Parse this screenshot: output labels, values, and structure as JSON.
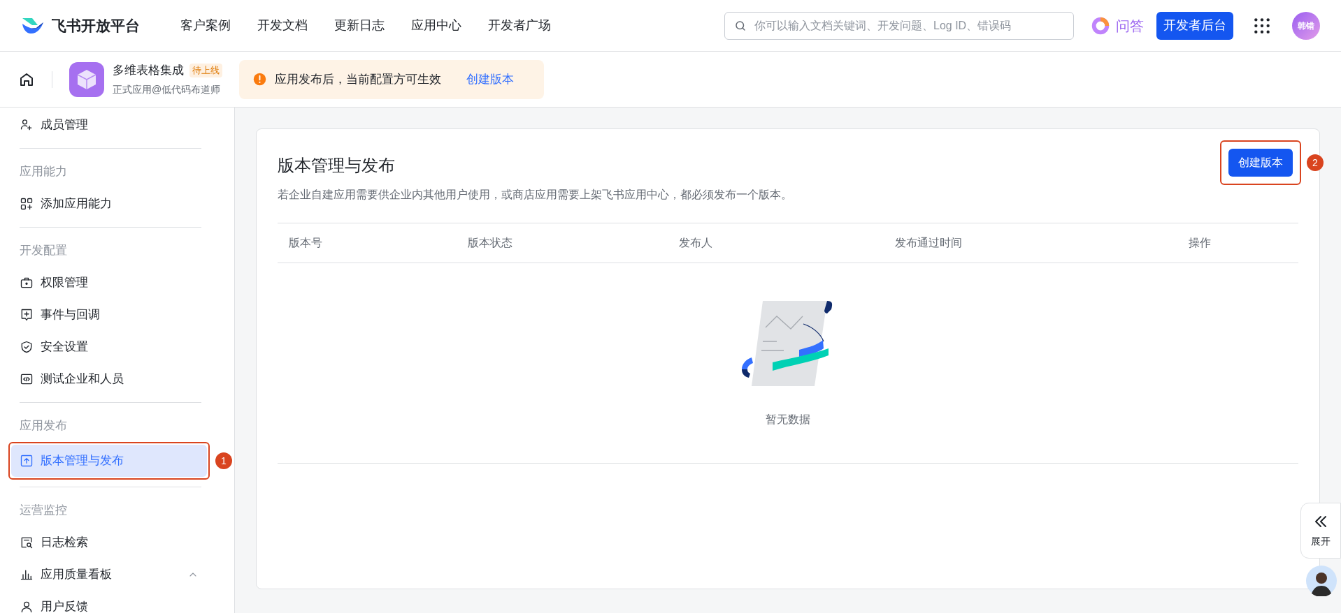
{
  "top_nav": {
    "logo_text": "飞书开放平台",
    "links": [
      {
        "label": "客户案例"
      },
      {
        "label": "开发文档"
      },
      {
        "label": "更新日志"
      },
      {
        "label": "应用中心"
      },
      {
        "label": "开发者广场"
      }
    ],
    "search": {
      "placeholder": "你可以输入文档关键词、开发问题、Log ID、错误码"
    },
    "qa_label": "问答",
    "console_button": "开发者后台",
    "avatar_text": "韩错"
  },
  "app_header": {
    "app_name": "多维表格集成",
    "status_tag": "待上线",
    "subtitle": "正式应用@低代码布道师",
    "notice": {
      "text": "应用发布后，当前配置方可生效",
      "link": "创建版本"
    }
  },
  "sidebar": {
    "items": [
      {
        "kind": "item",
        "label": "成员管理",
        "selected": false
      },
      {
        "kind": "divider"
      },
      {
        "kind": "section",
        "label": "应用能力"
      },
      {
        "kind": "item",
        "label": "添加应用能力",
        "selected": false
      },
      {
        "kind": "divider"
      },
      {
        "kind": "section",
        "label": "开发配置"
      },
      {
        "kind": "item",
        "label": "权限管理",
        "selected": false
      },
      {
        "kind": "item",
        "label": "事件与回调",
        "selected": false
      },
      {
        "kind": "item",
        "label": "安全设置",
        "selected": false
      },
      {
        "kind": "item",
        "label": "测试企业和人员",
        "selected": false
      },
      {
        "kind": "divider"
      },
      {
        "kind": "section",
        "label": "应用发布"
      },
      {
        "kind": "item",
        "label": "版本管理与发布",
        "selected": true,
        "annotation": "1"
      },
      {
        "kind": "divider"
      },
      {
        "kind": "section",
        "label": "运营监控"
      },
      {
        "kind": "item",
        "label": "日志检索",
        "selected": false
      },
      {
        "kind": "group",
        "label": "应用质量看板",
        "selected": false,
        "expanded": true
      },
      {
        "kind": "item",
        "label": "用户反馈",
        "selected": false
      }
    ]
  },
  "main": {
    "title": "版本管理与发布",
    "description": "若企业自建应用需要供企业内其他用户使用，或商店应用需要上架飞书应用中心，都必须发布一个版本。",
    "create_button": {
      "label": "创建版本",
      "annotation": "2"
    },
    "table": {
      "columns": [
        "版本号",
        "版本状态",
        "发布人",
        "发布通过时间",
        "操作"
      ]
    },
    "empty_text": "暂无数据"
  },
  "side_tab": {
    "label": "展开"
  }
}
